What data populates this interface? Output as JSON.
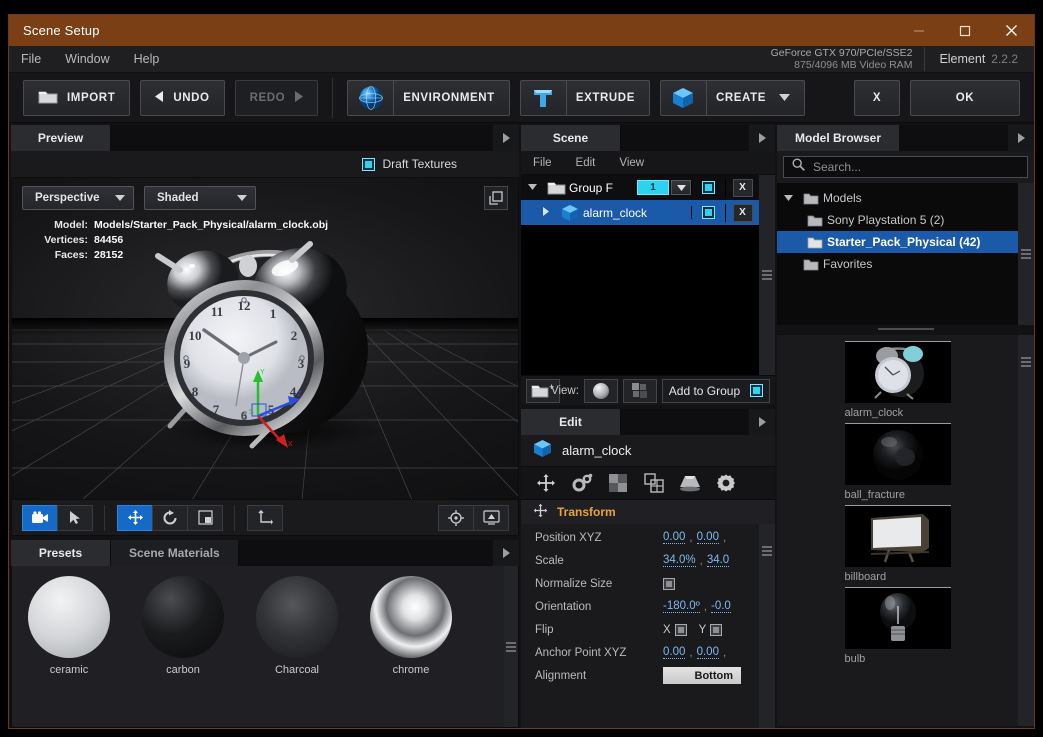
{
  "window": {
    "title": "Scene Setup",
    "minimize": "—",
    "maximize": "☐",
    "close": "✕"
  },
  "menubar": {
    "items": [
      "File",
      "Window",
      "Help"
    ],
    "gpu_name": "GeForce GTX 970/PCIe/SSE2",
    "gpu_ram": "875/4096 MB Video RAM",
    "product": "Element",
    "version": "2.2.2"
  },
  "toolbar": {
    "import": "IMPORT",
    "undo": "UNDO",
    "redo": "REDO",
    "environment": "ENVIRONMENT",
    "extrude": "EXTRUDE",
    "create": "CREATE",
    "cancel": "X",
    "ok": "OK"
  },
  "preview": {
    "tab": "Preview",
    "draft_textures_label": "Draft Textures",
    "draft_textures_checked": true,
    "camera_mode": "Perspective",
    "shading_mode": "Shaded",
    "info": {
      "model_key": "Model:",
      "model_value": "Models/Starter_Pack_Physical/alarm_clock.obj",
      "vertices_key": "Vertices:",
      "vertices_value": "84456",
      "faces_key": "Faces:",
      "faces_value": "28152"
    },
    "tools": [
      {
        "name": "camera-tool",
        "active": true
      },
      {
        "name": "select-tool",
        "active": false
      },
      {
        "name": "move-tool",
        "active": true
      },
      {
        "name": "rotate-tool",
        "active": false
      },
      {
        "name": "scale-tool",
        "active": false
      },
      {
        "name": "axis-tool",
        "active": false
      },
      {
        "name": "focus-tool",
        "active": false
      },
      {
        "name": "render-tool",
        "active": false
      }
    ]
  },
  "presets": {
    "tabs": [
      {
        "label": "Presets",
        "active": true
      },
      {
        "label": "Scene Materials",
        "active": false
      }
    ],
    "items": [
      {
        "label": "ceramic",
        "style": "white"
      },
      {
        "label": "carbon",
        "style": "black-gloss"
      },
      {
        "label": "Charcoal",
        "style": "dark"
      },
      {
        "label": "chrome",
        "style": "chrome"
      }
    ]
  },
  "scene": {
    "tab": "Scene",
    "menu": [
      "File",
      "Edit",
      "View"
    ],
    "rows": [
      {
        "name": "Group F",
        "indent": false,
        "expanded": true,
        "icon": "folder-icon",
        "count": "1",
        "visible": true,
        "delete": "X",
        "selected": false
      },
      {
        "name": "alarm_clock",
        "indent": true,
        "expanded": false,
        "icon": "cube-icon",
        "visible": true,
        "delete": "X",
        "selected": true
      }
    ],
    "footer": {
      "new_group": "new-group-icon",
      "view_label": "View:",
      "view_sphere": "sphere-preview-icon",
      "view_cube": "cube-preview-icon",
      "add_to_group": "Add to Group",
      "add_to_group_checked": true
    }
  },
  "edit": {
    "tab": "Edit",
    "object_name": "alarm_clock",
    "icons": [
      "transform-icon",
      "animation-icon",
      "texture-icon",
      "group-icon",
      "extrude-icon",
      "settings-icon"
    ],
    "section_title": "Transform",
    "properties": [
      {
        "key": "Position XYZ",
        "type": "nums",
        "values": [
          "0.00",
          "0.00"
        ],
        "trailing": ","
      },
      {
        "key": "Scale",
        "type": "nums",
        "values": [
          "34.0%",
          "34.0"
        ],
        "trailing": ""
      },
      {
        "key": "Normalize Size",
        "type": "checkbox",
        "checked": false
      },
      {
        "key": "Orientation",
        "type": "nums",
        "values": [
          "-180.0º",
          "-0.0"
        ],
        "trailing": ""
      },
      {
        "key": "Flip",
        "type": "flip",
        "axes": [
          "X",
          "Y"
        ]
      },
      {
        "key": "Anchor Point XYZ",
        "type": "nums",
        "values": [
          "0.00",
          "0.00"
        ],
        "trailing": ","
      },
      {
        "key": "Alignment",
        "type": "button",
        "value": "Bottom"
      }
    ]
  },
  "model_browser": {
    "tab": "Model Browser",
    "search_placeholder": "Search...",
    "search_value": "",
    "tree": [
      {
        "label": "Models",
        "indent": 0,
        "expanded": true,
        "selected": false
      },
      {
        "label": "Sony Playstation 5 (2)",
        "indent": 1,
        "expanded": false,
        "selected": false
      },
      {
        "label": "Starter_Pack_Physical (42)",
        "indent": 1,
        "expanded": false,
        "selected": true
      },
      {
        "label": "Favorites",
        "indent": 0,
        "expanded": false,
        "selected": false
      }
    ],
    "models": [
      {
        "label": "alarm_clock",
        "thumb": "alarm-clock"
      },
      {
        "label": "ball_fracture",
        "thumb": "ball"
      },
      {
        "label": "billboard",
        "thumb": "billboard"
      },
      {
        "label": "bulb",
        "thumb": "bulb"
      }
    ]
  },
  "colors": {
    "title_bar": "#7a3f14",
    "accent_blue": "#1a5aa8",
    "cyan": "#2ad4f0",
    "section_orange": "#e8a33c",
    "value_blue": "#7fb8f0"
  }
}
